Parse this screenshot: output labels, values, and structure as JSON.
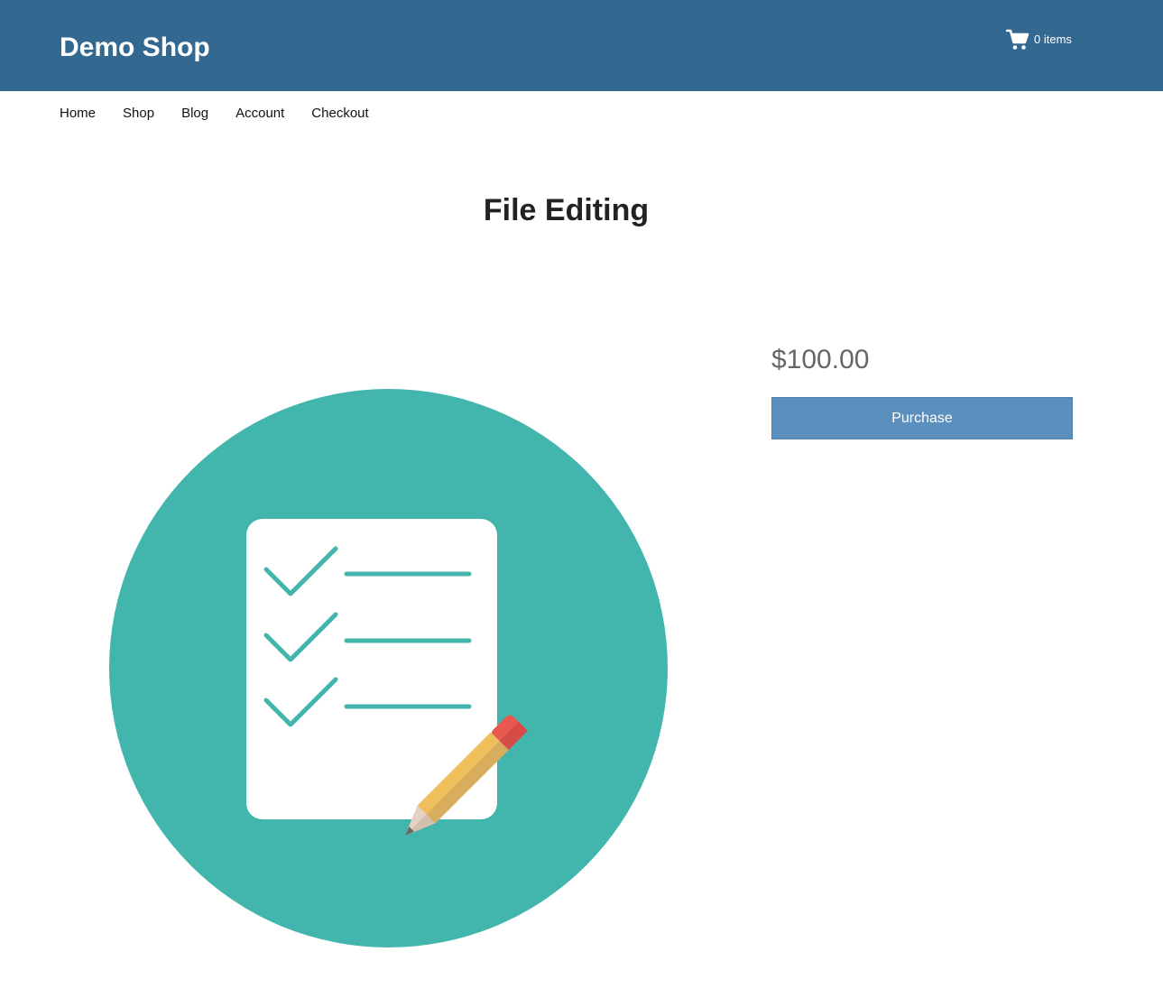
{
  "header": {
    "site_title": "Demo Shop",
    "cart_icon": "shopping-cart-icon",
    "cart_count": "0 items",
    "background": "#336891"
  },
  "nav": {
    "items": [
      {
        "label": "Home"
      },
      {
        "label": "Shop"
      },
      {
        "label": "Blog"
      },
      {
        "label": "Account"
      },
      {
        "label": "Checkout"
      }
    ]
  },
  "product": {
    "title": "File Editing",
    "price": "$100.00",
    "purchase_label": "Purchase",
    "image_icon": "checklist-with-pencil-illustration",
    "colors": {
      "circle": "#42b6ac",
      "button": "#5b8fbe",
      "pencil_body": "#efbe5d",
      "pencil_eraser": "#e9594f"
    }
  }
}
